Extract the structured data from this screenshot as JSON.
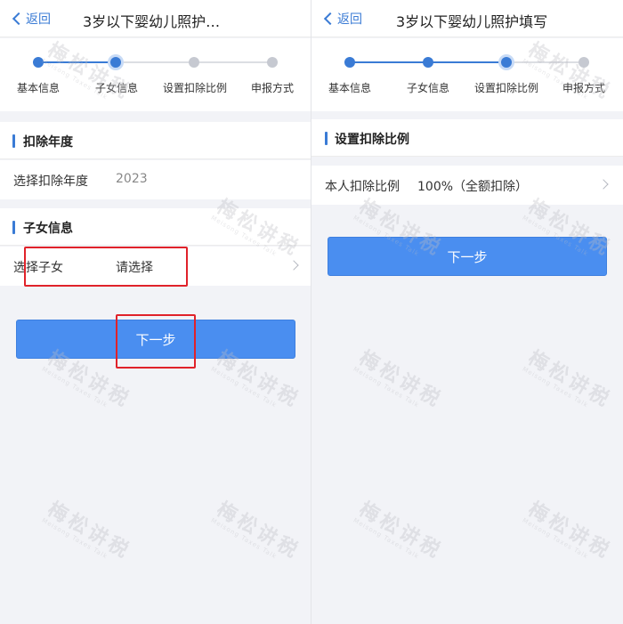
{
  "colors": {
    "accent": "#3a7bd5",
    "button": "#4a8ef0",
    "highlight": "#e0222a",
    "background": "#f2f3f7"
  },
  "left": {
    "back_label": "返回",
    "title": "3岁以下婴幼儿照护…",
    "steps": [
      "基本信息",
      "子女信息",
      "设置扣除比例",
      "申报方式"
    ],
    "current_step": 2,
    "deduction_year": {
      "section_title": "扣除年度",
      "label": "选择扣除年度",
      "value": "2023"
    },
    "child_info": {
      "section_title": "子女信息",
      "label": "选择子女",
      "placeholder": "请选择"
    },
    "next_label": "下一步"
  },
  "right": {
    "back_label": "返回",
    "title": "3岁以下婴幼儿照护填写",
    "steps": [
      "基本信息",
      "子女信息",
      "设置扣除比例",
      "申报方式"
    ],
    "current_step": 3,
    "ratio": {
      "section_title": "设置扣除比例",
      "label": "本人扣除比例",
      "value": "100%（全额扣除）"
    },
    "next_label": "下一步"
  },
  "watermark": {
    "text": "梅松讲税",
    "sub": "Meisong Taxes Talk"
  }
}
